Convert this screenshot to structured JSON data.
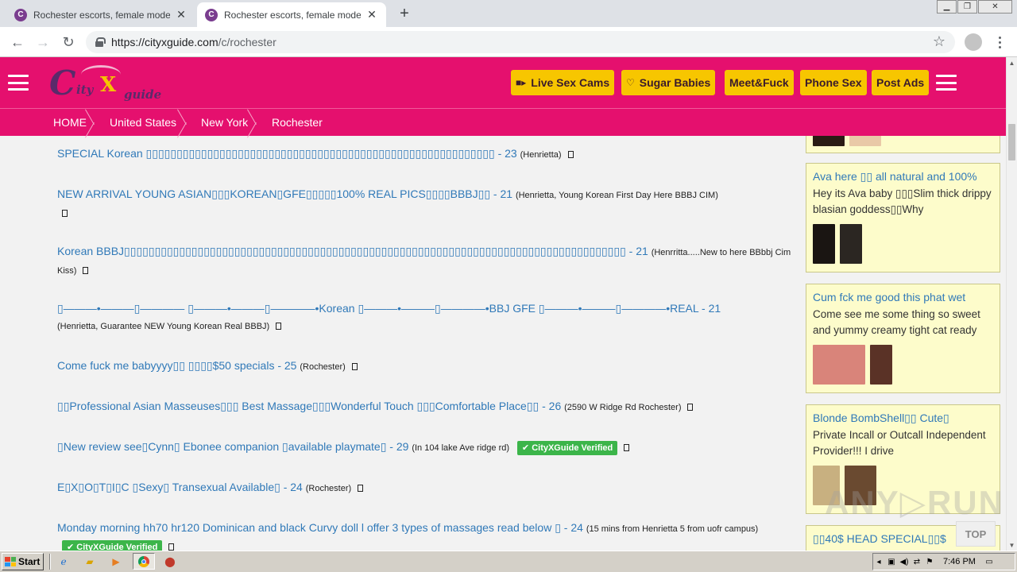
{
  "browser": {
    "tabs": [
      {
        "title": "Rochester escorts, female models, in",
        "close": "✕"
      },
      {
        "title": "Rochester escorts, female models, in",
        "close": "✕"
      }
    ],
    "new_tab": "+",
    "url_host": "https://cityxguide.com",
    "url_path": "/c/rochester",
    "icons": [
      "back-icon",
      "forward-icon",
      "reload-icon",
      "lock-icon",
      "bookmark-star-icon",
      "profile-icon",
      "menu-icon"
    ]
  },
  "header": {
    "logo": {
      "c": "C",
      "ity": "ity",
      "x": "X",
      "guide": "guide"
    },
    "buttons": [
      {
        "label": "Live Sex Cams",
        "icon": "video-camera-icon"
      },
      {
        "label": "Sugar Babies",
        "icon": "heart-chat-icon"
      },
      {
        "label": "Meet&Fuck",
        "icon": ""
      },
      {
        "label": "Phone Sex",
        "icon": ""
      },
      {
        "label": "Post Ads",
        "icon": ""
      }
    ],
    "colors": {
      "primary": "#e5106e",
      "button": "#f7c600",
      "link": "#3079b8",
      "ad_bg": "#fdfccb",
      "verified": "#3cb54a"
    }
  },
  "breadcrumb": [
    "HOME",
    "United States",
    "New York",
    "Rochester"
  ],
  "listings": [
    {
      "title": "SPECIAL Korean ▯▯▯▯▯▯▯▯▯▯▯▯▯▯▯▯▯▯▯▯▯▯▯▯▯▯▯▯▯▯▯▯▯▯▯▯▯▯▯▯▯▯▯▯▯▯▯▯▯▯▯▯▯▯▯▯▯ - 23",
      "location": "(Henrietta)",
      "verified": ""
    },
    {
      "title": "NEW ARRIVAL YOUNG ASIAN▯▯▯KOREAN▯GFE▯▯▯▯▯100% REAL PICS▯▯▯▯BBBJ▯▯ - 21",
      "location": "(Henrietta, Young Korean First Day Here BBBJ CIM)",
      "verified": ""
    },
    {
      "title": "Korean BBBJ▯▯▯▯▯▯▯▯▯▯▯▯▯▯▯▯▯▯▯▯▯▯▯▯▯▯▯▯▯▯▯▯▯▯▯▯▯▯▯▯▯▯▯▯▯▯▯▯▯▯▯▯▯▯▯▯▯▯▯▯▯▯▯▯▯▯▯▯▯▯▯▯▯▯▯▯▯▯▯▯▯▯ - 21",
      "location": "(Henrritta.....New to here BBbbj Cim Kiss)",
      "verified": ""
    },
    {
      "title": "▯———•———▯———— ▯———•———▯————•Korean ▯———•———▯————•BBJ GFE ▯———•———▯————•REAL - 21",
      "location": "(Henrietta, Guarantee NEW Young Korean Real BBBJ)",
      "verified": ""
    },
    {
      "title": "Come fuck me babyyyy▯▯ ▯▯▯▯$50 specials - 25",
      "location": "(Rochester)",
      "verified": ""
    },
    {
      "title": "▯▯Professional Asian Masseuses▯▯▯ Best Massage▯▯▯Wonderful Touch ▯▯▯Comfortable Place▯▯ - 26",
      "location": "(2590 W Ridge Rd Rochester)",
      "verified": ""
    },
    {
      "title": "▯New review see▯Cynn▯ Ebonee companion ▯available playmate▯ - 29",
      "location": "(In 104 lake Ave ridge rd)",
      "verified": "CityXGuide Verified"
    },
    {
      "title": "E▯X▯O▯T▯I▯C ▯Sexy▯ Transexual Available▯ - 24",
      "location": "(Rochester)",
      "verified": ""
    },
    {
      "title": "Monday morning hh70 hr120 Dominican and black Curvy doll l offer 3 types of massages read below ▯ - 24",
      "location": "(15 mins from Henrietta 5 from uofr campus)",
      "verified": "CityXGuide Verified"
    }
  ],
  "sidebar_ads": [
    {
      "title": "",
      "desc": "",
      "thumbs": [
        "#2a1c14",
        "#e9c9a7"
      ]
    },
    {
      "title": "Ava here ▯▯ all natural and 100%",
      "desc": "Hey its Ava baby ▯▯▯Slim thick drippy blasian goddess▯▯Why",
      "thumbs": [
        "#1a1512",
        "#2b2622"
      ]
    },
    {
      "title": "Cum fck me good this phat wet",
      "desc": "Come see me some thing so sweet and yummy creamy tight cat ready",
      "thumbs": [
        "#d9847a",
        "#5a3226"
      ]
    },
    {
      "title": "Blonde BombShell▯▯ Cute▯",
      "desc": "Private Incall or Outcall Independent Provider!!! I drive",
      "thumbs": [
        "#c8b080",
        "#6a4a30"
      ]
    },
    {
      "title": "▯▯40$ HEAD SPECIAL▯▯$",
      "desc": "",
      "thumbs": []
    }
  ],
  "top_button": "TOP",
  "watermark": "ANY▷RUN",
  "taskbar": {
    "start": "Start",
    "time": "7:46 PM",
    "apps": [
      "ie-icon",
      "folder-icon",
      "media-player-icon",
      "chrome-icon",
      "stop-icon"
    ]
  }
}
